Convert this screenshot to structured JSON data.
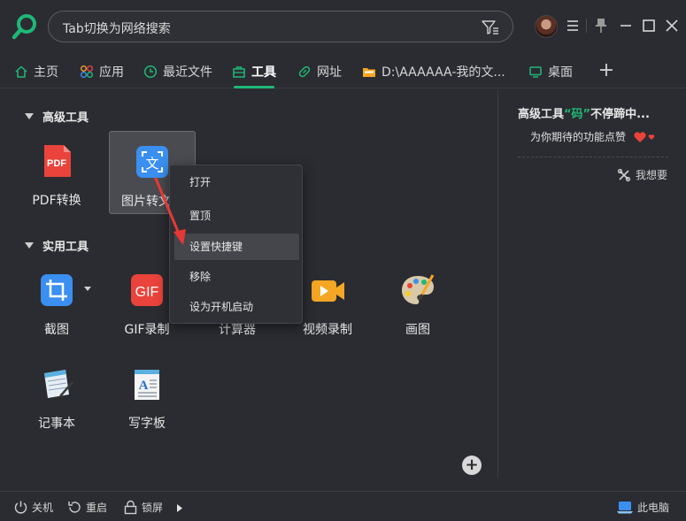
{
  "search": {
    "placeholder": "Tab切换为网络搜索"
  },
  "tabs": [
    {
      "label": "主页",
      "icon": "home-icon"
    },
    {
      "label": "应用",
      "icon": "apps-icon"
    },
    {
      "label": "最近文件",
      "icon": "clock-icon"
    },
    {
      "label": "工具",
      "icon": "toolbox-icon",
      "active": true
    },
    {
      "label": "网址",
      "icon": "link-icon"
    },
    {
      "label": "D:\\AAAAAA-我的文...",
      "icon": "folder-icon"
    },
    {
      "label": "桌面",
      "icon": "monitor-icon"
    }
  ],
  "sections": {
    "advanced": {
      "title": "高级工具"
    },
    "utility": {
      "title": "实用工具"
    }
  },
  "tools": {
    "pdf": "PDF转换",
    "ocr": "图片转文字",
    "screenshot": "截图",
    "gif": "GIF录制",
    "calculator": "计算器",
    "video": "视频录制",
    "paint": "画图",
    "notepad": "记事本",
    "wordpad": "写字板"
  },
  "context_menu": {
    "items": [
      "打开",
      "置顶",
      "设置快捷键",
      "移除",
      "设为开机启动"
    ],
    "hover_index": 2
  },
  "right_panel": {
    "title_prefix": "高级工具",
    "title_highlight": "“码”",
    "title_suffix": "不停蹄中...",
    "subtitle": "为你期待的功能点赞",
    "want": "我想要"
  },
  "bottom": {
    "shutdown": "关机",
    "restart": "重启",
    "lock": "锁屏",
    "computer": "此电脑"
  },
  "colors": {
    "accent": "#1fb877",
    "background": "#2b2c31",
    "menu_bg": "#2f3035",
    "arrow": "#e53935"
  }
}
